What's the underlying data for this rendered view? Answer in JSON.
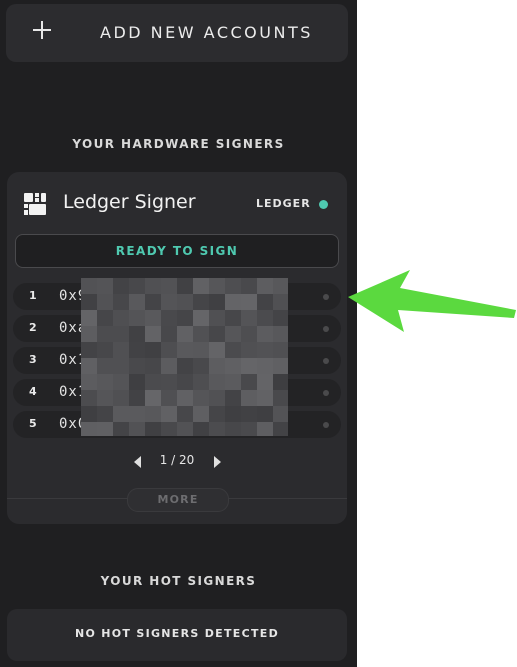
{
  "add_button": {
    "label": "ADD NEW ACCOUNTS",
    "icon": "plus-icon"
  },
  "hardware_section": {
    "title": "YOUR HARDWARE SIGNERS"
  },
  "signer_card": {
    "name": "Ledger Signer",
    "type_label": "LEDGER",
    "icon": "ledger-device-icon",
    "status_color": "#4fc9b0",
    "status_banner": "READY TO SIGN",
    "accounts": [
      {
        "index": "1",
        "address_prefix": "0x9"
      },
      {
        "index": "2",
        "address_prefix": "0xa"
      },
      {
        "index": "3",
        "address_prefix": "0x1"
      },
      {
        "index": "4",
        "address_prefix": "0x1"
      },
      {
        "index": "5",
        "address_prefix": "0x0"
      }
    ],
    "pagination": {
      "label": "1 / 20"
    },
    "more_button": "MORE"
  },
  "hot_section": {
    "title": "YOUR HOT SIGNERS",
    "empty_message": "NO HOT SIGNERS DETECTED"
  },
  "annotation": {
    "arrow_color": "#5bd93f",
    "icon": "green-arrow-icon"
  },
  "colors": {
    "panel_bg": "#1f1f21",
    "card_bg": "#2b2b2e",
    "accent": "#4fc9b0"
  }
}
